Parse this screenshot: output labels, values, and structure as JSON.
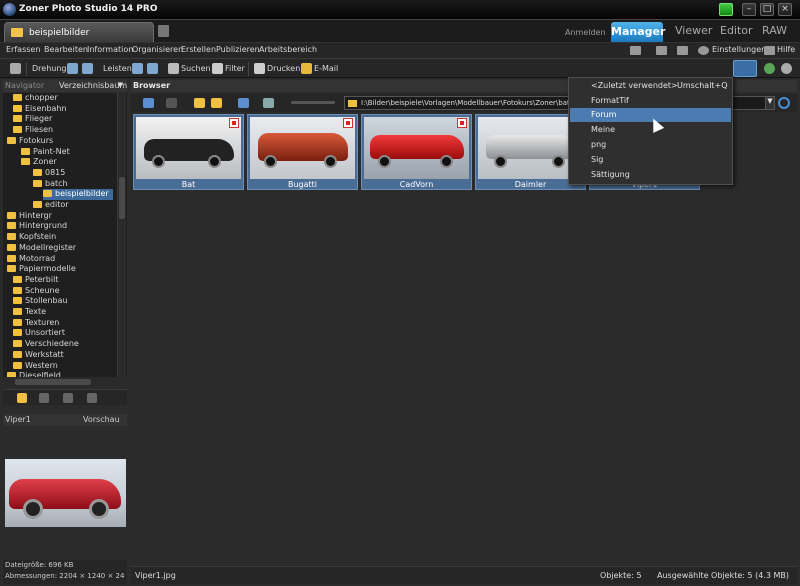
{
  "window": {
    "title": "Zoner Photo Studio 14 PRO"
  },
  "tabs": {
    "doc": "beispielbilder",
    "anmelden": "Anmelden",
    "manager": "Manager",
    "viewer": "Viewer",
    "editor": "Editor",
    "raw": "RAW"
  },
  "menu": [
    "Erfassen",
    "Bearbeiten",
    "Information",
    "Organisieren",
    "Erstellen",
    "Publizieren",
    "Arbeitsbereich"
  ],
  "menu_right": {
    "settings": "Einstellungen",
    "help": "Hilfe"
  },
  "toolbar": {
    "rotation": "Drehung:",
    "bars": "Leisten:",
    "search": "Suchen",
    "filter": "Filter",
    "print": "Drucken",
    "email": "E-Mail"
  },
  "navigator": {
    "title": "Navigator",
    "mode": "Verzeichnisbaum"
  },
  "tree": [
    "chopper",
    "Eisenbahn",
    "Flieger",
    "Fliesen",
    "Fotokurs",
    "Paint-Net",
    "Zoner",
    "0815",
    "batch",
    "beispielbilder",
    "editor",
    "Hintergr",
    "Hintergrund",
    "Kopfstein",
    "Modellregister",
    "Motorrad",
    "Papiermodelle",
    "Peterbilt",
    "Scheune",
    "Stollenbau",
    "Texte",
    "Texturen",
    "Unsortiert",
    "Verschiedene",
    "Werkstatt",
    "Western",
    "Dieselfield"
  ],
  "preview": {
    "name": "Viper1",
    "mode": "Vorschau"
  },
  "left_status": {
    "size": "Dateigröße: 696 KB",
    "dims": "Abmessungen: 2204 × 1240 × 24"
  },
  "browser": {
    "title": "Browser",
    "path": "I:\\Bilder\\beispiele\\Vorlagen\\Modellbauer\\Fotokurs\\Zoner\\batch\\beispielbilder"
  },
  "thumbnails": [
    "Bat",
    "Bugatti",
    "CadVorn",
    "Daimler",
    "Viper1"
  ],
  "dropdown": {
    "recent": "<Zuletzt verwendet>",
    "shortcut": "Umschalt+Q",
    "items": [
      "FormatTif",
      "Forum",
      "Meine",
      "png",
      "Sig",
      "Sättigung"
    ]
  },
  "status": {
    "file": "Viper1.jpg",
    "objects": "Objekte: 5",
    "selected": "Ausgewählte Objekte: 5 (4.3 MB)"
  },
  "colors": {
    "accent": "#1f84cf",
    "selection": "#4a6d96",
    "folder": "#f0c040"
  }
}
